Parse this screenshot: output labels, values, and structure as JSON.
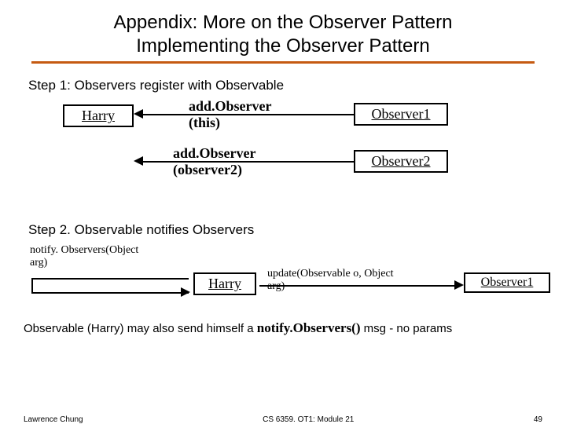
{
  "title": {
    "line1": "Appendix: More on the Observer Pattern",
    "line2": "Implementing the Observer Pattern"
  },
  "step1": "Step 1: Observers register with Observable",
  "objects": {
    "harry": "Harry",
    "observer1": "Observer1",
    "observer2": "Observer2"
  },
  "messages": {
    "addObserverThis_l1": "add.Observer",
    "addObserverThis_l2": "(this)",
    "addObserver2_l1": "add.Observer",
    "addObserver2_l2": "(observer2)"
  },
  "step2": "Step 2. Observable notifies Observers",
  "diagram2": {
    "notify_l1": "notify. Observers(Object",
    "notify_l2": "arg)",
    "harry": "Harry",
    "update_l1": "update(Observable o, Object",
    "update_l2": "arg)",
    "observer1": "Observer1"
  },
  "note": {
    "pre": "Observable (Harry) may also send himself a ",
    "bold": "notify.Observers()",
    "post": " msg - no params"
  },
  "footer": {
    "left": "Lawrence Chung",
    "center": "CS 6359. OT1: Module 21",
    "right": "49"
  }
}
